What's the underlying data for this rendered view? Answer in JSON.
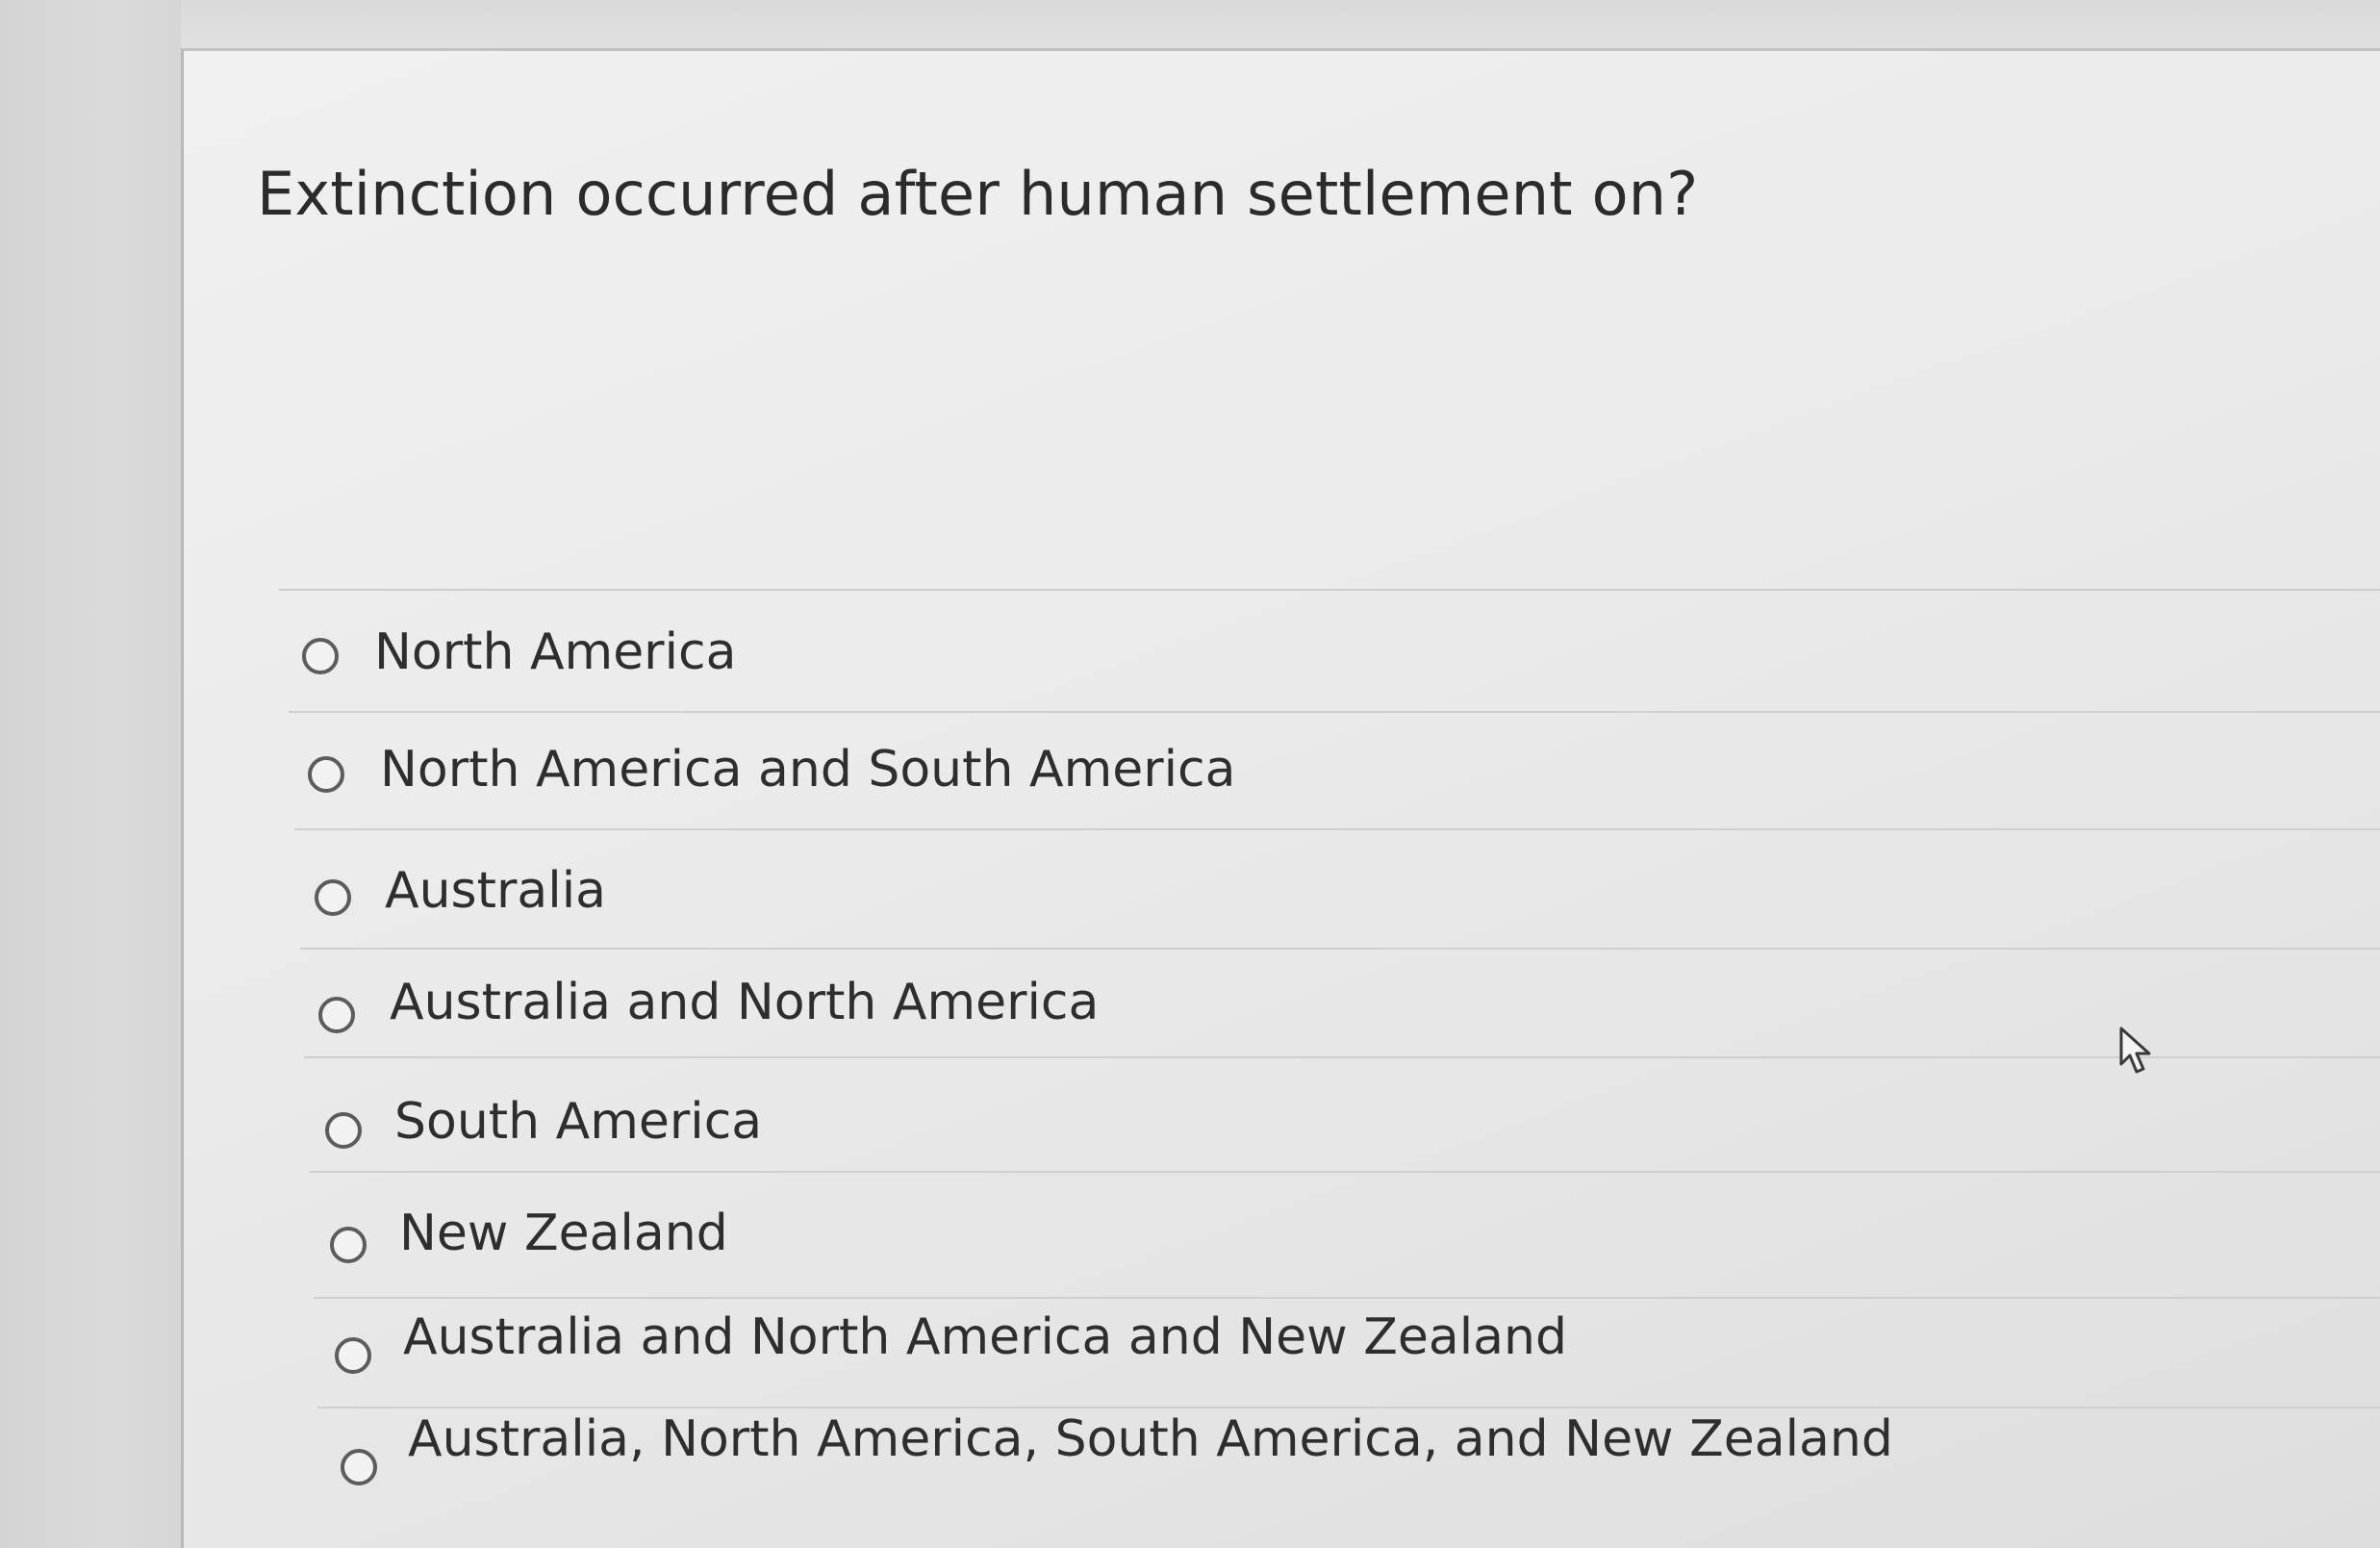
{
  "question": {
    "text": "Extinction occurred after human settlement on?"
  },
  "options": [
    {
      "label": "North America",
      "selected": false
    },
    {
      "label": "North America and South America",
      "selected": false
    },
    {
      "label": "Australia",
      "selected": false
    },
    {
      "label": "Australia and North America",
      "selected": false
    },
    {
      "label": "South America",
      "selected": false
    },
    {
      "label": "New Zealand",
      "selected": false
    },
    {
      "label": "Australia and North America and New Zealand",
      "selected": false
    },
    {
      "label": "Australia, North America, South America, and New Zealand",
      "selected": false
    }
  ],
  "cursor": {
    "icon": "arrow-pointer-icon"
  }
}
